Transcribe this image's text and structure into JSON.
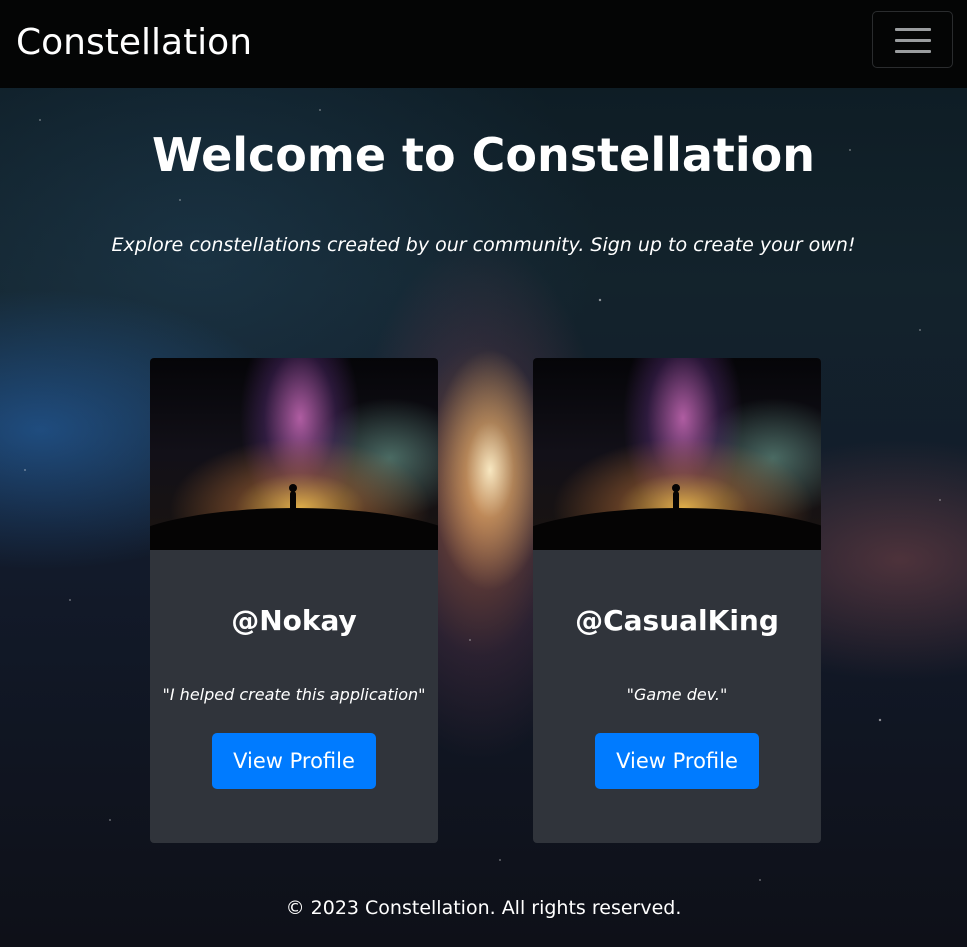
{
  "navbar": {
    "brand": "Constellation",
    "toggler_icon": "hamburger-menu-icon"
  },
  "hero": {
    "title": "Welcome to Constellation",
    "subtitle": "Explore constellations created by our community. Sign up to create your own!"
  },
  "cards": [
    {
      "username": "@Nokay",
      "bio": "\"I helped create this application\"",
      "button_label": "View Profile"
    },
    {
      "username": "@CasualKing",
      "bio": "\"Game dev.\"",
      "button_label": "View Profile"
    }
  ],
  "footer": {
    "copyright": "© 2023 Constellation. All rights reserved."
  },
  "colors": {
    "navbar_bg": "#040505",
    "card_bg": "#30343b",
    "button_primary": "#007bff",
    "text": "#ffffff"
  }
}
